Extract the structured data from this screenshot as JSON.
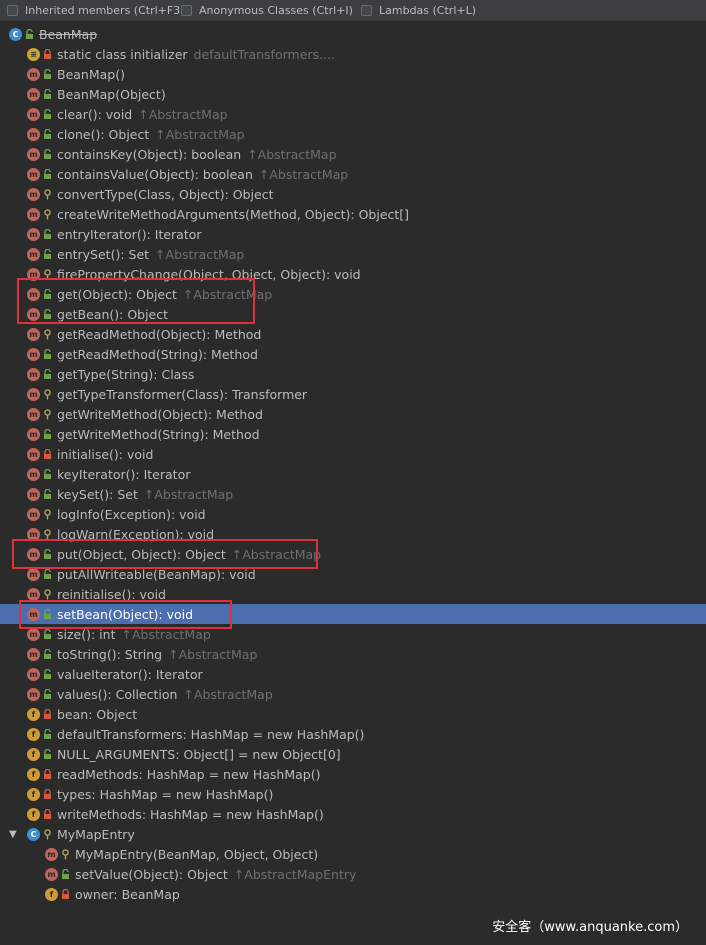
{
  "toolbar": {
    "options": [
      {
        "label": "Inherited members (Ctrl+F3)"
      },
      {
        "label": "Anonymous Classes (Ctrl+I)"
      },
      {
        "label": "Lambdas (Ctrl+L)"
      }
    ]
  },
  "tree": {
    "root": {
      "icon": "class-icon",
      "label": "BeanMap"
    },
    "items": [
      {
        "kind": "static",
        "vis": "private",
        "text": "static class initializer",
        "inherited": "defaultTransformers....",
        "indent": 1
      },
      {
        "kind": "method",
        "vis": "public",
        "text": "BeanMap()",
        "inherited": "",
        "indent": 1
      },
      {
        "kind": "method",
        "vis": "public",
        "text": "BeanMap(Object)",
        "inherited": "",
        "indent": 1
      },
      {
        "kind": "method",
        "vis": "public",
        "text": "clear(): void",
        "inherited": "↑AbstractMap",
        "indent": 1
      },
      {
        "kind": "method",
        "vis": "public",
        "text": "clone(): Object",
        "inherited": "↑AbstractMap",
        "indent": 1
      },
      {
        "kind": "method",
        "vis": "public",
        "text": "containsKey(Object): boolean",
        "inherited": "↑AbstractMap",
        "indent": 1
      },
      {
        "kind": "method",
        "vis": "public",
        "text": "containsValue(Object): boolean",
        "inherited": "↑AbstractMap",
        "indent": 1
      },
      {
        "kind": "method",
        "vis": "protected",
        "text": "convertType(Class, Object): Object",
        "inherited": "",
        "indent": 1
      },
      {
        "kind": "method",
        "vis": "protected",
        "text": "createWriteMethodArguments(Method, Object): Object[]",
        "inherited": "",
        "indent": 1
      },
      {
        "kind": "method",
        "vis": "public",
        "text": "entryIterator(): Iterator",
        "inherited": "",
        "indent": 1
      },
      {
        "kind": "method",
        "vis": "public",
        "text": "entrySet(): Set",
        "inherited": "↑AbstractMap",
        "indent": 1
      },
      {
        "kind": "method",
        "vis": "protected",
        "text": "firePropertyChange(Object, Object, Object): void",
        "inherited": "",
        "indent": 1
      },
      {
        "kind": "method",
        "vis": "public",
        "text": "get(Object): Object",
        "inherited": "↑AbstractMap",
        "indent": 1
      },
      {
        "kind": "method",
        "vis": "public",
        "text": "getBean(): Object",
        "inherited": "",
        "indent": 1
      },
      {
        "kind": "method",
        "vis": "protected",
        "text": "getReadMethod(Object): Method",
        "inherited": "",
        "indent": 1
      },
      {
        "kind": "method",
        "vis": "public",
        "text": "getReadMethod(String): Method",
        "inherited": "",
        "indent": 1
      },
      {
        "kind": "method",
        "vis": "public",
        "text": "getType(String): Class",
        "inherited": "",
        "indent": 1
      },
      {
        "kind": "method",
        "vis": "protected",
        "text": "getTypeTransformer(Class): Transformer",
        "inherited": "",
        "indent": 1
      },
      {
        "kind": "method",
        "vis": "protected",
        "text": "getWriteMethod(Object): Method",
        "inherited": "",
        "indent": 1
      },
      {
        "kind": "method",
        "vis": "public",
        "text": "getWriteMethod(String): Method",
        "inherited": "",
        "indent": 1
      },
      {
        "kind": "method",
        "vis": "private",
        "text": "initialise(): void",
        "inherited": "",
        "indent": 1
      },
      {
        "kind": "method",
        "vis": "public",
        "text": "keyIterator(): Iterator",
        "inherited": "",
        "indent": 1
      },
      {
        "kind": "method",
        "vis": "public",
        "text": "keySet(): Set",
        "inherited": "↑AbstractMap",
        "indent": 1
      },
      {
        "kind": "method",
        "vis": "protected",
        "text": "logInfo(Exception): void",
        "inherited": "",
        "indent": 1
      },
      {
        "kind": "method",
        "vis": "protected",
        "text": "logWarn(Exception): void",
        "inherited": "",
        "indent": 1
      },
      {
        "kind": "method",
        "vis": "public",
        "text": "put(Object, Object): Object",
        "inherited": "↑AbstractMap",
        "indent": 1
      },
      {
        "kind": "method",
        "vis": "public",
        "text": "putAllWriteable(BeanMap): void",
        "inherited": "",
        "indent": 1
      },
      {
        "kind": "method",
        "vis": "protected",
        "text": "reinitialise(): void",
        "inherited": "",
        "indent": 1
      },
      {
        "kind": "method",
        "vis": "public",
        "text": "setBean(Object): void",
        "inherited": "",
        "indent": 1,
        "selected": true
      },
      {
        "kind": "method",
        "vis": "public",
        "text": "size(): int",
        "inherited": "↑AbstractMap",
        "indent": 1
      },
      {
        "kind": "method",
        "vis": "public",
        "text": "toString(): String",
        "inherited": "↑AbstractMap",
        "indent": 1
      },
      {
        "kind": "method",
        "vis": "public",
        "text": "valueIterator(): Iterator",
        "inherited": "",
        "indent": 1
      },
      {
        "kind": "method",
        "vis": "public",
        "text": "values(): Collection",
        "inherited": "↑AbstractMap",
        "indent": 1
      },
      {
        "kind": "field",
        "vis": "private",
        "text": "bean: Object",
        "inherited": "",
        "indent": 1
      },
      {
        "kind": "fieldstatic",
        "vis": "public",
        "text": "defaultTransformers: HashMap = new HashMap()",
        "inherited": "",
        "indent": 1
      },
      {
        "kind": "fieldstatic",
        "vis": "public",
        "text": "NULL_ARGUMENTS: Object[] = new Object[0]",
        "inherited": "",
        "indent": 1
      },
      {
        "kind": "field",
        "vis": "private",
        "text": "readMethods: HashMap = new HashMap()",
        "inherited": "",
        "indent": 1
      },
      {
        "kind": "field",
        "vis": "private",
        "text": "types: HashMap = new HashMap()",
        "inherited": "",
        "indent": 1
      },
      {
        "kind": "field",
        "vis": "private",
        "text": "writeMethods: HashMap = new HashMap()",
        "inherited": "",
        "indent": 1
      },
      {
        "kind": "class",
        "vis": "protected",
        "text": "MyMapEntry",
        "inherited": "",
        "indent": 1,
        "expanded": true
      },
      {
        "kind": "method",
        "vis": "protected",
        "text": "MyMapEntry(BeanMap, Object, Object)",
        "inherited": "",
        "indent": 2
      },
      {
        "kind": "method",
        "vis": "public",
        "text": "setValue(Object): Object",
        "inherited": "↑AbstractMapEntry",
        "indent": 2
      },
      {
        "kind": "field",
        "vis": "private",
        "text": "owner: BeanMap",
        "inherited": "",
        "indent": 2
      }
    ]
  },
  "colors": {
    "background": "#2b2b2b",
    "selection": "#4b6eaf",
    "highlight_box": "#e0303a",
    "method_icon": "#c0645c",
    "field_icon": "#cf9a3a",
    "class_icon": "#3e8fd0"
  },
  "watermark": "安全客（www.anquanke.com）"
}
